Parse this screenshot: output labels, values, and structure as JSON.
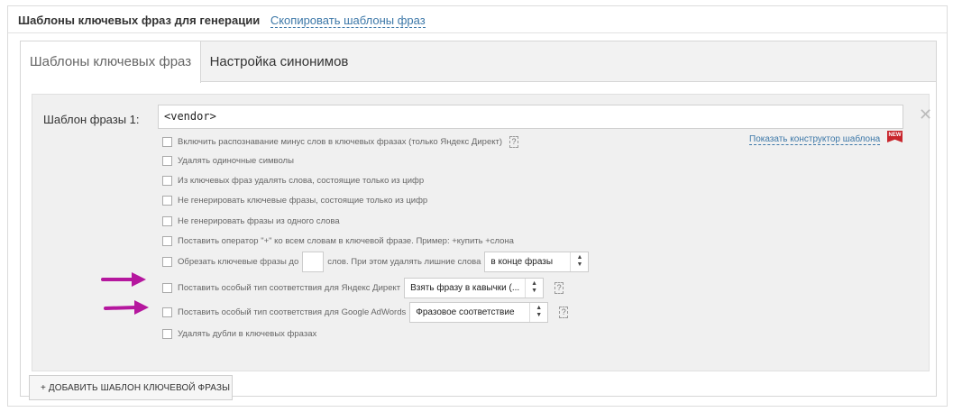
{
  "header": {
    "title": "Шаблоны ключевых фраз для генерации",
    "copy_link": "Скопировать шаблоны фраз"
  },
  "tabs": [
    {
      "label": "Шаблоны ключевых фраз",
      "active": true
    },
    {
      "label": "Настройка синонимов",
      "active": false
    }
  ],
  "template": {
    "label": "Шаблон фразы 1:",
    "value": "<vendor>",
    "constructor_link": "Показать конструктор шаблона",
    "new_badge": "NEW"
  },
  "options": {
    "minus_words": "Включить распознавание минус слов в ключевых фразах (только Яндекс Директ)",
    "single_chars": "Удалять одиночные символы",
    "digits_only_words": "Из ключевых фраз удалять слова, состоящие только из цифр",
    "no_digit_phrases": "Не генерировать ключевые фразы, состоящие только из цифр",
    "no_single_word": "Не генерировать фразы из одного слова",
    "plus_operator": "Поставить оператор \"+\" ко всем словам в ключевой фразе. Пример: +купить +слона",
    "trim_prefix": "Обрезать ключевые фразы до",
    "trim_suffix": "слов. При этом удалять лишние слова",
    "trim_select": "в конце фразы",
    "yandex_match": "Поставить особый тип соответствия для Яндекс Директ",
    "yandex_select": "Взять фразу в кавычки (...",
    "google_match": "Поставить особый тип соответствия для Google AdWords",
    "google_select": "Фразовое соответствие",
    "dedupe": "Удалять дубли в ключевых фразах",
    "help_glyph": "?"
  },
  "add_button": "+ ДОБАВИТЬ ШАБЛОН КЛЮЧЕВОЙ ФРАЗЫ",
  "colors": {
    "link": "#3d78a8",
    "annotation_arrow": "#b5179e",
    "new_badge": "#c8252c"
  }
}
